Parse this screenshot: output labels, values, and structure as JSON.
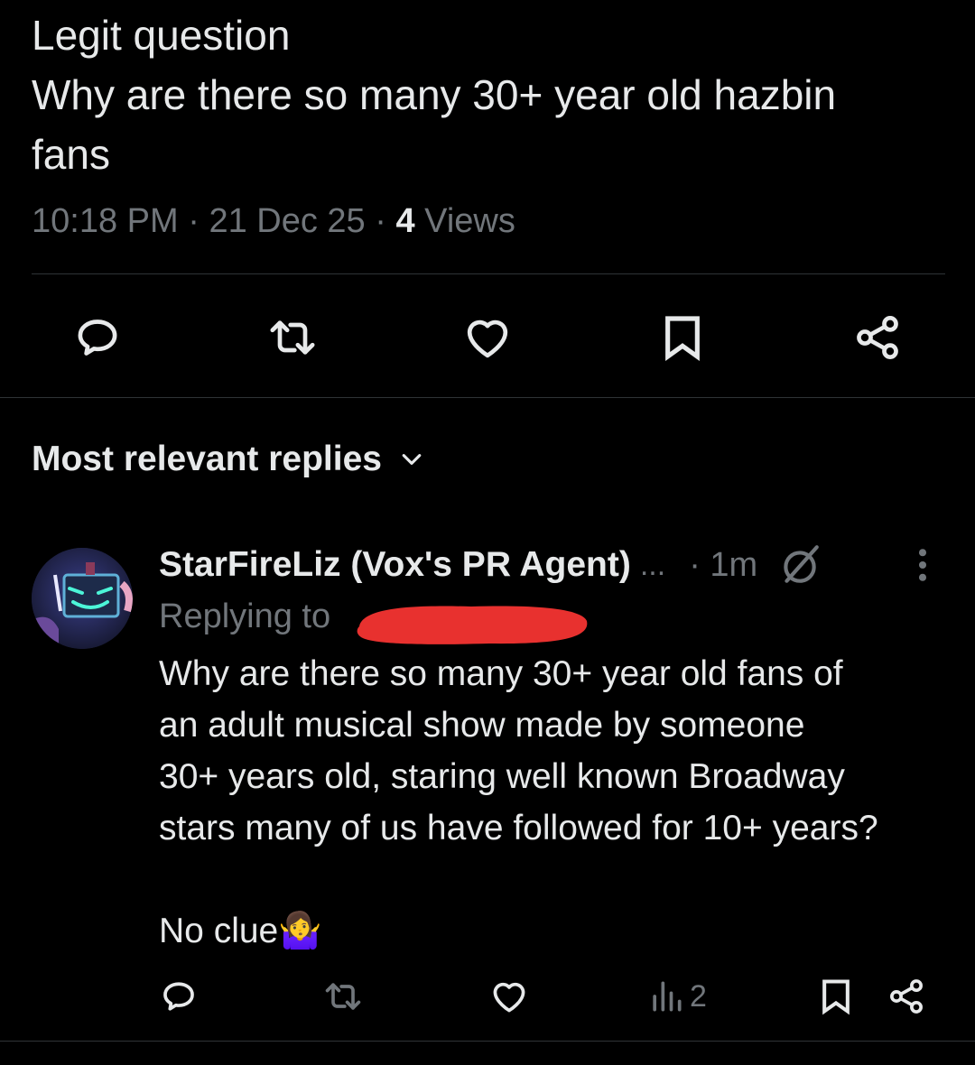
{
  "tweet": {
    "lines": [
      "Legit question",
      "Why are there so many 30+ year old hazbin",
      "fans"
    ],
    "time": "10:18 PM",
    "date": "21 Dec 25",
    "views_count": "4",
    "views_label": "Views"
  },
  "separator": "·",
  "actions": {
    "icons": [
      "reply-icon",
      "retweet-icon",
      "like-icon",
      "bookmark-icon",
      "share-icon"
    ]
  },
  "replies_section": {
    "sort_label": "Most relevant replies",
    "sort_icon": "chevron-down-icon"
  },
  "reply": {
    "author_name": "StarFireLiz (Vox's PR Agent)",
    "truncation": "...",
    "time": "1m",
    "replying_to_label": "Replying to",
    "text_lines": [
      "Why are there so many 30+ year old fans of",
      "an adult musical show made by someone",
      "30+ years old, staring well known Broadway",
      "stars many of us have followed for 10+ years?",
      "",
      "No clue🤷‍♀️"
    ],
    "views": "2",
    "icons": [
      "reply-icon",
      "retweet-icon",
      "like-icon",
      "views-icon",
      "bookmark-icon",
      "share-icon"
    ]
  },
  "colors": {
    "background": "#000000",
    "text_primary": "#e7e9ea",
    "text_secondary": "#71767b",
    "divider": "#2f3336",
    "redaction": "#e8312f"
  }
}
